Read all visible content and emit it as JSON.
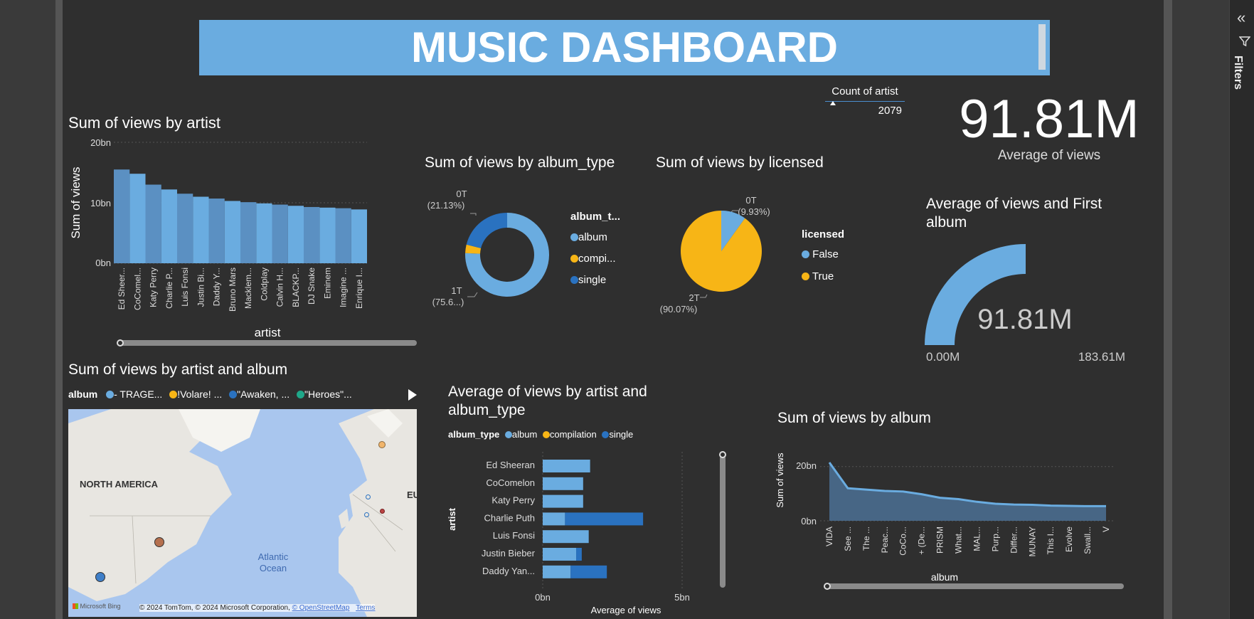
{
  "filters_pane": {
    "label": "Filters",
    "collapse_icon": "double-chevron-left-icon",
    "filter_icon": "funnel-icon"
  },
  "banner": {
    "title": "MUSIC DASHBOARD",
    "color": "#6aace0"
  },
  "colors": {
    "blue_light": "#6aace0",
    "blue_dark": "#2a72c0",
    "yellow": "#f7b516",
    "teal": "#1fa88a",
    "area": "#4a6d8f"
  },
  "count_card": {
    "label": "Count of artist",
    "value": "2079"
  },
  "average_card": {
    "value": "91.81M",
    "label": "Average of views"
  },
  "gauge": {
    "title": "Average of views and First album",
    "value_label": "91.81M",
    "min_label": "0.00M",
    "max_label": "183.61M",
    "fraction": 0.5
  },
  "artist_chart": {
    "title": "Sum of views by artist",
    "xlabel": "artist",
    "ylabel": "Sum of views",
    "ticks": [
      "20bn",
      "10bn",
      "0bn"
    ]
  },
  "album_type_chart": {
    "title": "Sum of views by album_type",
    "legend_title": "album_t...",
    "legend": [
      "album",
      "compi...",
      "single"
    ],
    "label_top_value": "0T",
    "label_top_pct": "(21.13%)",
    "label_bottom_value": "1T",
    "label_bottom_pct": "(75.6...)"
  },
  "licensed_chart": {
    "title": "Sum of views by licensed",
    "legend_title": "licensed",
    "legend": [
      "False",
      "True"
    ],
    "label_top_value": "0T",
    "label_top_pct": "(9.93%)",
    "label_bottom_value": "2T",
    "label_bottom_pct": "(90.07%)"
  },
  "map_chart": {
    "title": "Sum of views by artist and album",
    "legend_title": "album",
    "legend": [
      "- TRAGE...",
      "!Volare! ...",
      "\"Awaken, ...",
      "\"Heroes\"..."
    ],
    "label_na": "NORTH AMERICA",
    "label_ocean_1": "Atlantic",
    "label_ocean_2": "Ocean",
    "label_eu": "EU",
    "bing": "Microsoft Bing",
    "copyright": "© 2024 TomTom, © 2024 Microsoft Corporation,",
    "osm": "© OpenStreetMap",
    "terms": "Terms"
  },
  "bar_chart": {
    "title_1": "Average of views by artist and",
    "title_2": "album_type",
    "legend_title": "album_type",
    "legend": [
      "album",
      "compilation",
      "single"
    ],
    "ylabel": "artist",
    "xlabel": "Average of views",
    "ticks": [
      "0bn",
      "5bn"
    ]
  },
  "album_chart": {
    "title": "Sum of views by album",
    "xlabel": "album",
    "ylabel": "Sum of views",
    "ticks": [
      "20bn",
      "0bn"
    ]
  },
  "chart_data": [
    {
      "type": "bar",
      "title": "Sum of views by artist",
      "xlabel": "artist",
      "ylabel": "Sum of views",
      "ylim": [
        0,
        20
      ],
      "categories": [
        "Ed Sheer...",
        "CoComel...",
        "Katy Perry",
        "Charlie P...",
        "Luis Fonsi",
        "Justin Bi...",
        "Daddy Y...",
        "Bruno Mars",
        "Macklem...",
        "Coldplay",
        "Calvin H...",
        "BLACKP...",
        "DJ Snake",
        "Eminem",
        "Imagine ...",
        "Enrique I..."
      ],
      "values": [
        15.5,
        14.8,
        13.0,
        12.2,
        11.5,
        11.0,
        10.7,
        10.3,
        10.1,
        9.9,
        9.7,
        9.5,
        9.3,
        9.2,
        9.1,
        8.9
      ]
    },
    {
      "type": "pie",
      "title": "Sum of views by album_type",
      "categories": [
        "album",
        "compilation",
        "single"
      ],
      "values": [
        75.6,
        3.27,
        21.13
      ]
    },
    {
      "type": "pie",
      "title": "Sum of views by licensed",
      "categories": [
        "False",
        "True"
      ],
      "values": [
        9.93,
        90.07
      ]
    },
    {
      "type": "bar",
      "title": "Average of views by artist and album_type",
      "xlabel": "Average of views",
      "ylabel": "artist",
      "xlim": [
        0,
        5
      ],
      "categories": [
        "Ed Sheeran",
        "CoComelon",
        "Katy Perry",
        "Charlie Puth",
        "Luis Fonsi",
        "Justin Bieber",
        "Daddy Yan..."
      ],
      "series": [
        {
          "name": "album",
          "values": [
            1.7,
            1.45,
            1.45,
            0.8,
            1.65,
            1.2,
            1.0
          ]
        },
        {
          "name": "single",
          "values": [
            0,
            0,
            0,
            2.8,
            0,
            0.2,
            1.3
          ]
        }
      ]
    },
    {
      "type": "area",
      "title": "Sum of views by album",
      "xlabel": "album",
      "ylabel": "Sum of views",
      "categories": [
        "VIDA",
        "See ...",
        "The ...",
        "Peac...",
        "CoCo...",
        "+ (De...",
        "PRISM",
        "What...",
        "MAL...",
        "Purp...",
        "Differ...",
        "MUNAY",
        "This I...",
        "Evolve",
        "Swall...",
        "V"
      ],
      "values": [
        21.5,
        12.0,
        11.5,
        11.0,
        10.8,
        9.8,
        8.5,
        8.0,
        7.0,
        6.3,
        6.0,
        5.9,
        5.6,
        5.5,
        5.4,
        5.4
      ]
    }
  ]
}
